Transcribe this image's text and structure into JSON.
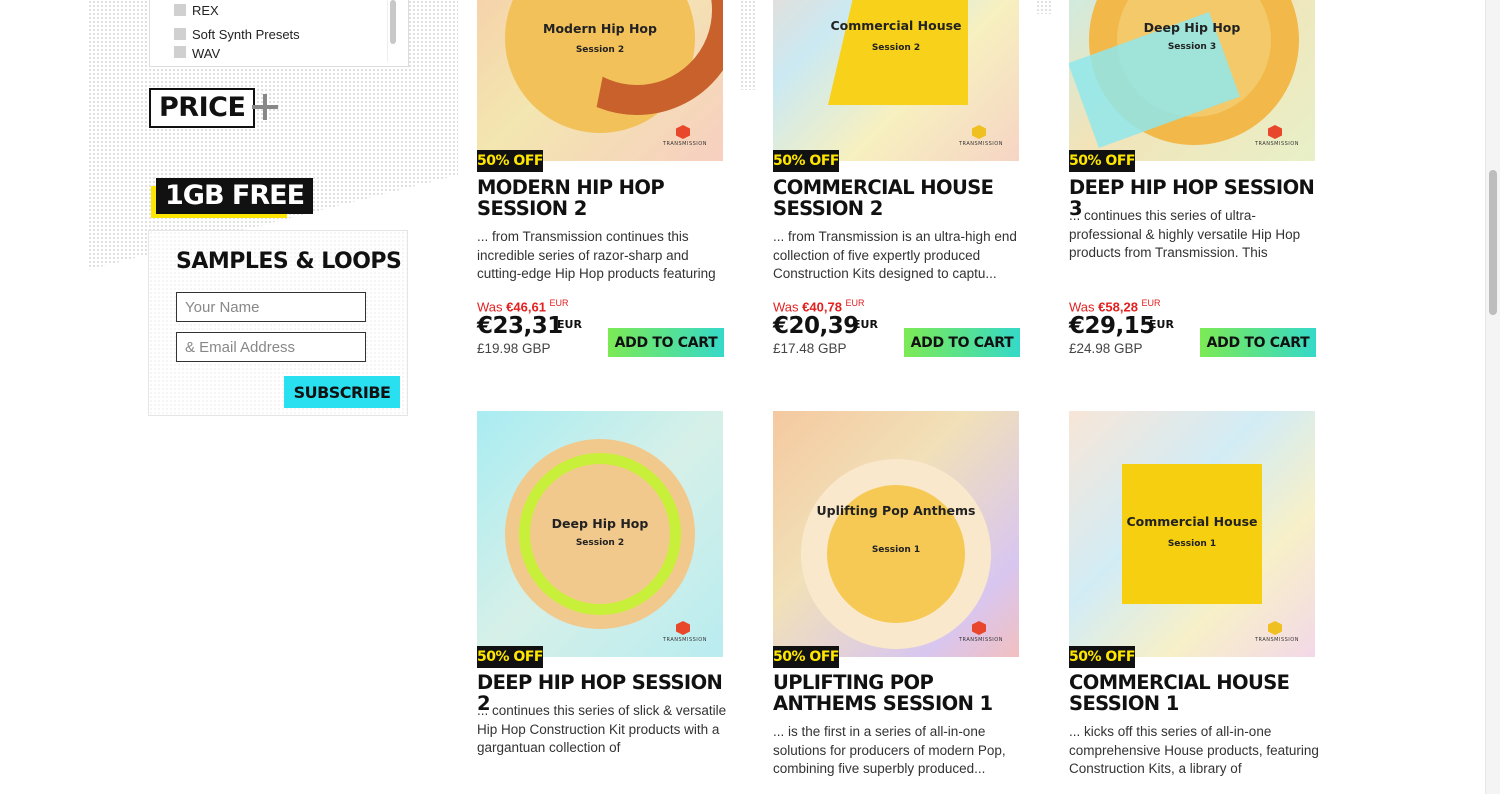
{
  "filters": {
    "format_items": [
      "REX",
      "Soft Synth Presets",
      "WAV"
    ],
    "price_heading": "PRICE",
    "free_badge": "1GB FREE"
  },
  "newsletter": {
    "heading": "SAMPLES & LOOPS",
    "name_placeholder": "Your Name",
    "email_placeholder": "& Email Address",
    "subscribe_label": "SUBSCRIBE"
  },
  "products": [
    {
      "cover_title": "Modern Hip Hop",
      "cover_sub": "Session 2",
      "badge": "50% OFF",
      "title": "MODERN HIP HOP SESSION 2",
      "desc": "... from Transmission continues this incredible series of razor-sharp and cutting-edge Hip Hop products featuring",
      "was_label": "Was",
      "was_price": "€46,61",
      "was_cur": "EUR",
      "price": "€23,31",
      "cur": "EUR",
      "gbp": "£19.98 GBP",
      "cart": "ADD TO CART"
    },
    {
      "cover_title": "Commercial House",
      "cover_sub": "Session 2",
      "badge": "50% OFF",
      "title": "COMMERCIAL HOUSE SESSION 2",
      "desc": "... from Transmission is an ultra-high end collection of five expertly produced Construction Kits designed to captu...",
      "was_label": "Was",
      "was_price": "€40,78",
      "was_cur": "EUR",
      "price": "€20,39",
      "cur": "EUR",
      "gbp": "£17.48 GBP",
      "cart": "ADD TO CART"
    },
    {
      "cover_title": "Deep Hip Hop",
      "cover_sub": "Session 3",
      "badge": "50% OFF",
      "title": "DEEP HIP HOP SESSION 3",
      "desc": "... continues this series of ultra-professional & highly versatile Hip Hop products from Transmission. This",
      "was_label": "Was",
      "was_price": "€58,28",
      "was_cur": "EUR",
      "price": "€29,15",
      "cur": "EUR",
      "gbp": "£24.98 GBP",
      "cart": "ADD TO CART"
    },
    {
      "cover_title": "Deep Hip Hop",
      "cover_sub": "Session 2",
      "badge": "50% OFF",
      "title": "DEEP HIP HOP SESSION 2",
      "desc": "... continues this series of slick & versatile Hip Hop Construction Kit products with a gargantuan collection of"
    },
    {
      "cover_title": "Uplifting Pop Anthems",
      "cover_sub": "Session 1",
      "badge": "50% OFF",
      "title": "UPLIFTING POP ANTHEMS SESSION 1",
      "desc": "... is the first in a series of all-in-one solutions for producers of modern Pop, combining five superbly produced..."
    },
    {
      "cover_title": "Commercial House",
      "cover_sub": "Session 1",
      "badge": "50% OFF",
      "title": "COMMERCIAL HOUSE SESSION 1",
      "desc": "... kicks off this series of all-in-one comprehensive House products, featuring Construction Kits, a library of"
    }
  ],
  "brand": "TRANSMISSION",
  "colors": {
    "badge_text": "#ffe600",
    "was_price": "#e32020",
    "subscribe": "#29e0f0",
    "cart_from": "#7cea54",
    "cart_to": "#35d9c8"
  }
}
